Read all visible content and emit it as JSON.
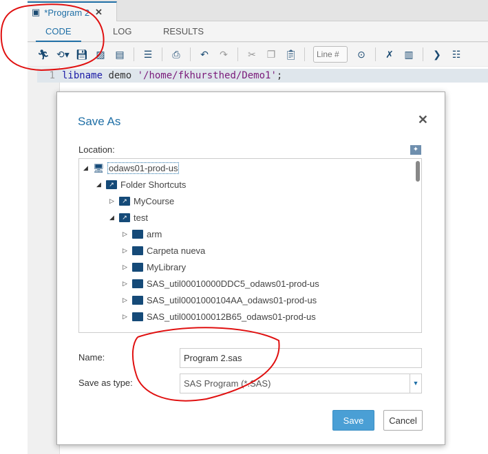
{
  "doc_tab": {
    "title": "*Program 2",
    "close": "✕"
  },
  "subtabs": [
    "CODE",
    "LOG",
    "RESULTS"
  ],
  "toolbar": {
    "line_placeholder": "Line #"
  },
  "editor": {
    "line_number": "1",
    "kw": "libname",
    "ident": " demo ",
    "str": "'/home/fkhursthed/Demo1'",
    "end": ";"
  },
  "dialog": {
    "title": "Save As",
    "close": "✕",
    "location_label": "Location:",
    "tree": [
      {
        "label": "odaws01-prod-us",
        "level": 0,
        "expanded": true,
        "icon": "server-icon"
      },
      {
        "label": "Folder Shortcuts",
        "level": 1,
        "expanded": true,
        "icon": "folder-shortcut-icon"
      },
      {
        "label": "MyCourse",
        "level": 2,
        "expanded": false,
        "icon": "folder-shortcut-icon"
      },
      {
        "label": "test",
        "level": 2,
        "expanded": true,
        "icon": "folder-shortcut-icon"
      },
      {
        "label": "arm",
        "level": 3,
        "expanded": false,
        "icon": "folder-icon"
      },
      {
        "label": "Carpeta nueva",
        "level": 3,
        "expanded": false,
        "icon": "folder-icon"
      },
      {
        "label": "MyLibrary",
        "level": 3,
        "expanded": false,
        "icon": "folder-icon"
      },
      {
        "label": "SAS_util00010000DDC5_odaws01-prod-us",
        "level": 3,
        "expanded": false,
        "icon": "folder-icon"
      },
      {
        "label": "SAS_util0001000104AA_odaws01-prod-us",
        "level": 3,
        "expanded": false,
        "icon": "folder-icon"
      },
      {
        "label": "SAS_util000100012B65_odaws01-prod-us",
        "level": 3,
        "expanded": false,
        "icon": "folder-icon"
      }
    ],
    "name_label": "Name:",
    "name_value": "Program 2.sas",
    "type_label": "Save as type:",
    "type_value": "SAS Program (*.SAS)",
    "save": "Save",
    "cancel": "Cancel"
  }
}
